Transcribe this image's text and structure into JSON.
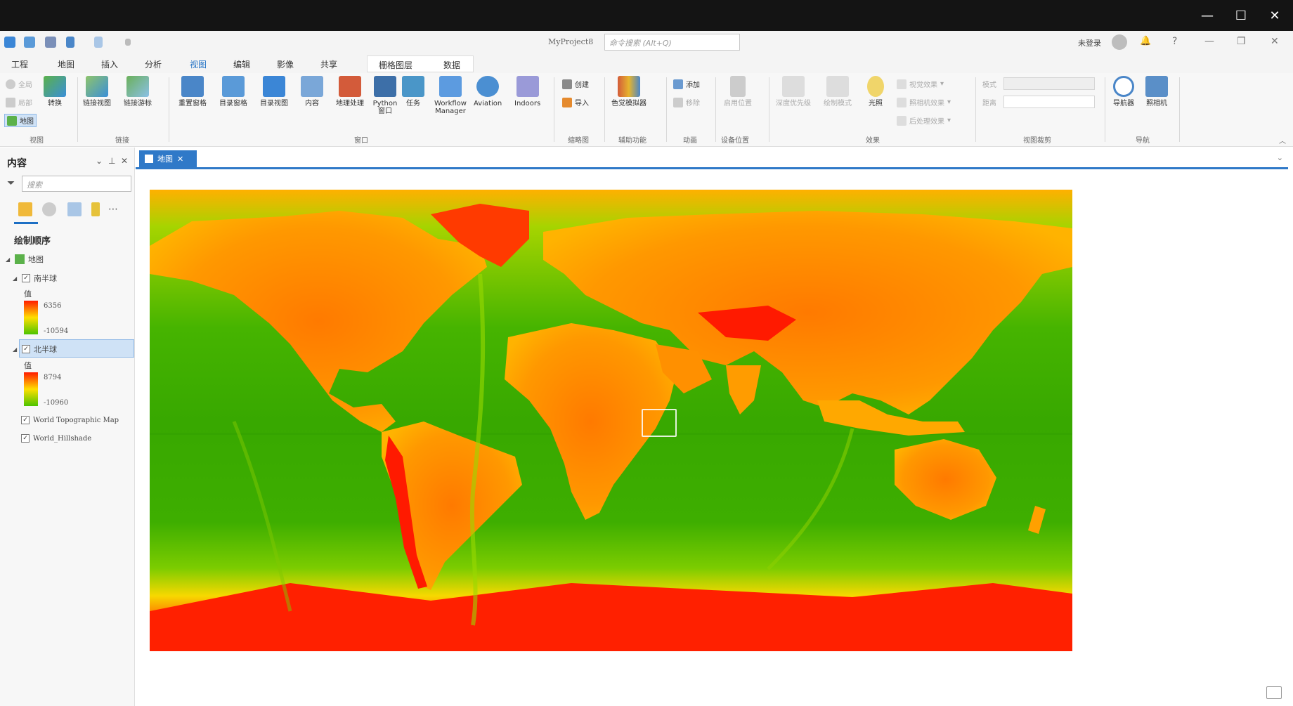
{
  "window": {
    "minimize_glyph": "—",
    "maximize_glyph": "☐",
    "close_glyph": "✕"
  },
  "app": {
    "project_name": "MyProject8",
    "command_search_placeholder": "命令搜索 (Alt+Q)",
    "user_name": "未登录",
    "help_glyph": "?",
    "minimize_glyph": "—",
    "restore_glyph": "❐",
    "close_glyph": "✕",
    "bell_glyph": "🔔"
  },
  "ribbon_tabs": [
    "工程",
    "地图",
    "插入",
    "分析",
    "视图",
    "编辑",
    "影像",
    "共享"
  ],
  "active_tab": "视图",
  "context_tabs": [
    "栅格图层",
    "数据"
  ],
  "ribbon": {
    "view_group": {
      "small_items": [
        "全局",
        "局部",
        "地图"
      ],
      "convert_label": "转换",
      "group_label": "视图"
    },
    "link_group": {
      "buttons": [
        "链接视图",
        "链接游标"
      ],
      "group_label": "链接"
    },
    "window_group": {
      "buttons": [
        "重置窗格",
        "目录窗格",
        "目录视图",
        "内容",
        "地理处理",
        "Python 窗口",
        "任务",
        "Workflow Manager",
        "Aviation",
        "Indoors"
      ],
      "group_label": "窗口"
    },
    "thumb_group": {
      "small_items": [
        "创建",
        "导入"
      ],
      "group_label": "缩略图"
    },
    "accessibility_group": {
      "buttons": [
        "色觉模拟器"
      ],
      "group_label": "辅助功能"
    },
    "animation_group": {
      "small_items": [
        "添加",
        "移除"
      ],
      "group_label": "动画"
    },
    "device_group": {
      "buttons": [
        "启用位置"
      ],
      "group_label": "设备位置"
    },
    "effects_group": {
      "buttons": [
        "深度优先级",
        "绘制模式",
        "光照"
      ],
      "small_items": [
        "视觉效果",
        "照相机效果",
        "后处理效果"
      ],
      "group_label": "效果"
    },
    "view_clip_group": {
      "labels": [
        "模式",
        "距离"
      ],
      "group_label": "视图裁剪"
    },
    "nav_group": {
      "buttons": [
        "导航器",
        "照相机"
      ],
      "group_label": "导航"
    }
  },
  "contents_pane": {
    "title": "内容",
    "search_placeholder": "搜索",
    "draw_order_label": "绘制顺序",
    "layers": {
      "map": "地图",
      "southern": "南半球",
      "southern_value_label": "值",
      "southern_max": "6356",
      "southern_min": "-10594",
      "northern": "北半球",
      "northern_value_label": "值",
      "northern_max": "8794",
      "northern_min": "-10960",
      "topo": "World Topographic Map",
      "hillshade": "World_Hillshade"
    }
  },
  "map_view": {
    "tab_label": "地图",
    "tab_close": "✕"
  }
}
